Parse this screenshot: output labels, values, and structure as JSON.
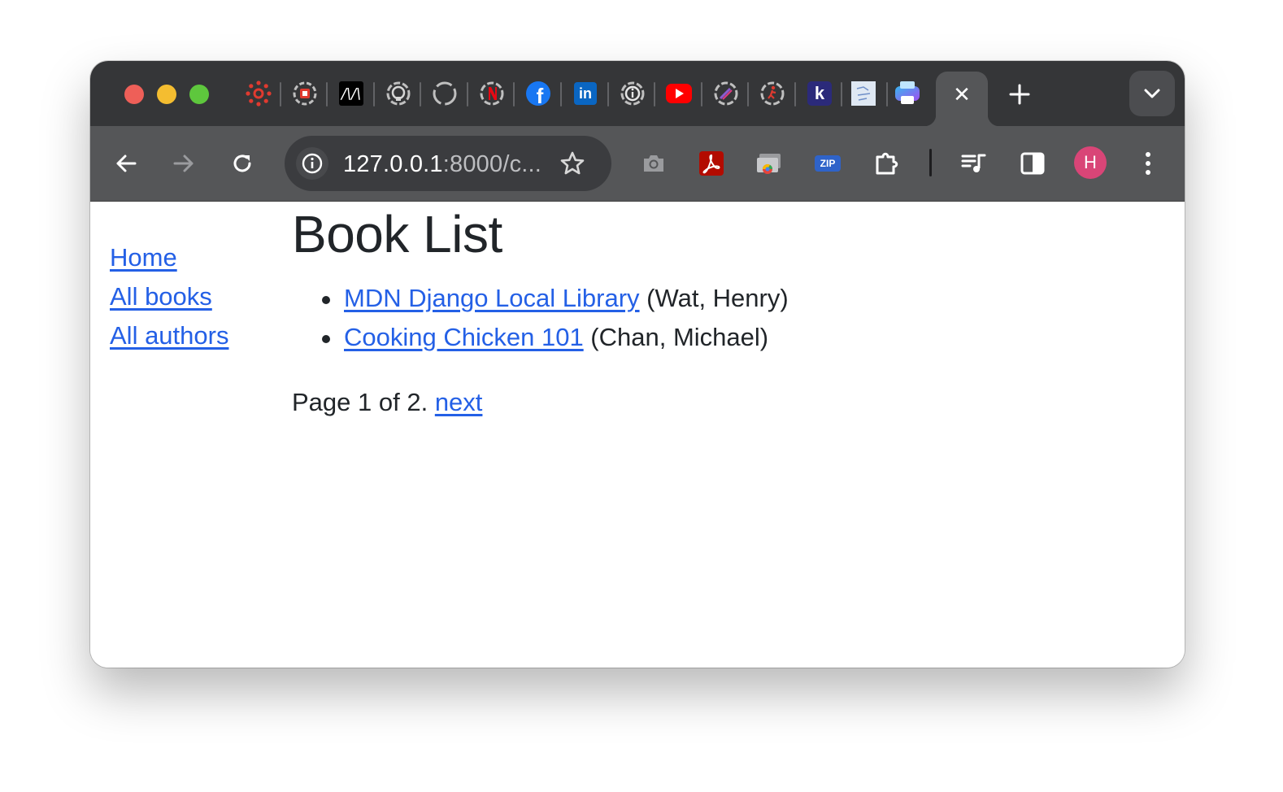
{
  "browser": {
    "tabs": [
      {
        "icon": "canvas-icon",
        "color": "#e03a2f"
      },
      {
        "icon": "gear-badge-icon",
        "color": "#c0c0c0"
      },
      {
        "icon": "m-logo-icon",
        "label": "/\\/\\",
        "color": "#000000"
      },
      {
        "icon": "github-icon",
        "color": "#c0c0c0"
      },
      {
        "icon": "loading-circle-icon",
        "color": "#c0c0c0"
      },
      {
        "icon": "netflix-icon",
        "color": "#e50914"
      },
      {
        "icon": "facebook-icon",
        "label": "f",
        "color": "#1877f2"
      },
      {
        "icon": "linkedin-icon",
        "label": "in",
        "color": "#0a66c2"
      },
      {
        "icon": "info-circle-icon",
        "color": "#c0c0c0"
      },
      {
        "icon": "youtube-icon",
        "color": "#ff0000"
      },
      {
        "icon": "pen-circle-icon",
        "color": "#8a5cd0"
      },
      {
        "icon": "runner-circle-icon",
        "color": "#e03a2f"
      },
      {
        "icon": "k-logo-icon",
        "label": "k",
        "color": "#2b2a7a"
      },
      {
        "icon": "image-thumb-icon",
        "color": "#dfe8f3"
      },
      {
        "icon": "printer-app-icon",
        "color": "#7a5cf0"
      }
    ],
    "active_tab_close": "✕",
    "new_tab": "+",
    "address_bar": {
      "host": "127.0.0.1",
      "rest": ":8000/c..."
    },
    "extensions": [
      {
        "icon": "camera-icon"
      },
      {
        "icon": "acrobat-icon"
      },
      {
        "icon": "screencast-icon"
      },
      {
        "icon": "zip-icon",
        "label": "ZIP"
      },
      {
        "icon": "puzzle-extension-icon"
      }
    ],
    "profile_initial": "H",
    "profile_color": "#d94577"
  },
  "sidebar": {
    "links": [
      "Home",
      "All books",
      "All authors"
    ]
  },
  "main": {
    "title": "Book List",
    "books": [
      {
        "title": "MDN Django Local Library",
        "author": " (Wat, Henry)"
      },
      {
        "title": "Cooking Chicken 101",
        "author": " (Chan, Michael)"
      }
    ],
    "pagination": {
      "text": "Page 1 of 2. ",
      "next_label": "next"
    }
  }
}
